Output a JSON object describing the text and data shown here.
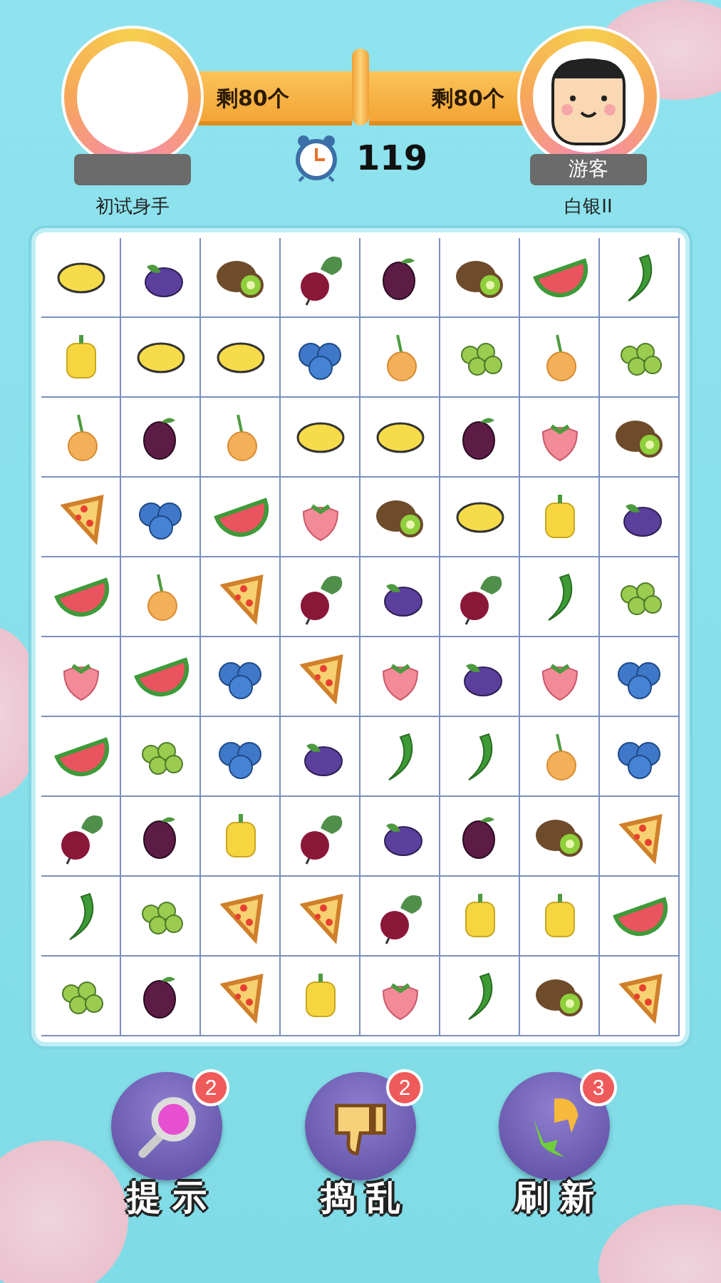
{
  "players": [
    {
      "kind": "blank",
      "remaining": "剩80个",
      "rank": "初试身手"
    },
    {
      "kind": "face",
      "name": "游客",
      "remaining": "剩80个",
      "rank": "白银II"
    }
  ],
  "timer": "119",
  "board": [
    [
      {
        "kind": "mango"
      },
      {
        "kind": "plum"
      },
      {
        "kind": "kiwi"
      },
      {
        "kind": "beet"
      },
      {
        "kind": "darkplum"
      },
      {
        "kind": "kiwi"
      },
      {
        "kind": "watermelon"
      },
      {
        "kind": "pea"
      }
    ],
    [
      {
        "kind": "pepper"
      },
      {
        "kind": "mango"
      },
      {
        "kind": "mango"
      },
      {
        "kind": "blueberry"
      },
      {
        "kind": "onion"
      },
      {
        "kind": "sprouts"
      },
      {
        "kind": "onion"
      },
      {
        "kind": "sprouts"
      }
    ],
    [
      {
        "kind": "onion"
      },
      {
        "kind": "darkplum"
      },
      {
        "kind": "onion"
      },
      {
        "kind": "mango"
      },
      {
        "kind": "mango"
      },
      {
        "kind": "darkplum"
      },
      {
        "kind": "strawberry"
      },
      {
        "kind": "kiwi"
      }
    ],
    [
      {
        "kind": "pizza"
      },
      {
        "kind": "blueberry"
      },
      {
        "kind": "watermelon"
      },
      {
        "kind": "strawberry"
      },
      {
        "kind": "kiwi"
      },
      {
        "kind": "mango"
      },
      {
        "kind": "pepper"
      },
      {
        "kind": "plum"
      }
    ],
    [
      {
        "kind": "watermelon"
      },
      {
        "kind": "onion"
      },
      {
        "kind": "pizza"
      },
      {
        "kind": "beet"
      },
      {
        "kind": "plum"
      },
      {
        "kind": "beet"
      },
      {
        "kind": "pea"
      },
      {
        "kind": "sprouts"
      }
    ],
    [
      {
        "kind": "strawberry"
      },
      {
        "kind": "watermelon"
      },
      {
        "kind": "blueberry"
      },
      {
        "kind": "pizza"
      },
      {
        "kind": "strawberry"
      },
      {
        "kind": "plum"
      },
      {
        "kind": "strawberry"
      },
      {
        "kind": "blueberry"
      }
    ],
    [
      {
        "kind": "watermelon"
      },
      {
        "kind": "sprouts"
      },
      {
        "kind": "blueberry"
      },
      {
        "kind": "plum"
      },
      {
        "kind": "pea"
      },
      {
        "kind": "pea"
      },
      {
        "kind": "onion"
      },
      {
        "kind": "blueberry"
      }
    ],
    [
      {
        "kind": "beet"
      },
      {
        "kind": "darkplum"
      },
      {
        "kind": "pepper"
      },
      {
        "kind": "beet"
      },
      {
        "kind": "plum"
      },
      {
        "kind": "darkplum"
      },
      {
        "kind": "kiwi"
      },
      {
        "kind": "pizza"
      }
    ],
    [
      {
        "kind": "pea"
      },
      {
        "kind": "sprouts"
      },
      {
        "kind": "pizza"
      },
      {
        "kind": "pizza"
      },
      {
        "kind": "beet"
      },
      {
        "kind": "pepper"
      },
      {
        "kind": "pepper"
      },
      {
        "kind": "watermelon"
      }
    ],
    [
      {
        "kind": "sprouts"
      },
      {
        "kind": "darkplum"
      },
      {
        "kind": "pizza"
      },
      {
        "kind": "pepper"
      },
      {
        "kind": "strawberry"
      },
      {
        "kind": "pea"
      },
      {
        "kind": "kiwi"
      },
      {
        "kind": "pizza"
      }
    ]
  ],
  "tools": [
    {
      "kind": "magnifier",
      "label": "提示",
      "count": "2"
    },
    {
      "kind": "thumbs-down",
      "label": "捣乱",
      "count": "2"
    },
    {
      "kind": "refresh",
      "label": "刷新",
      "count": "3"
    }
  ]
}
